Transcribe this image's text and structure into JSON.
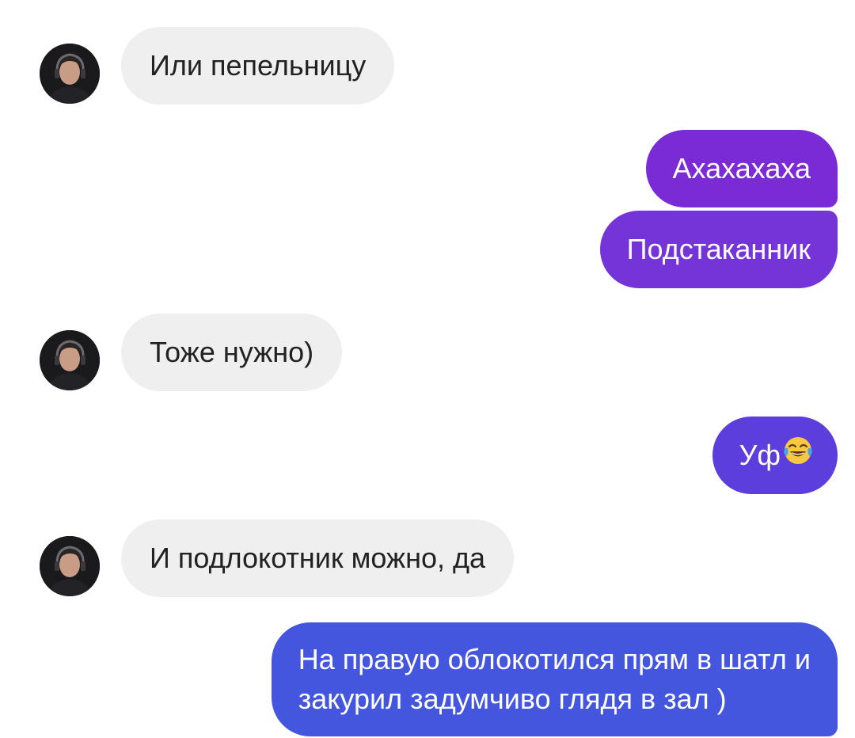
{
  "messages": [
    {
      "direction": "incoming",
      "text": "Или пепельницу"
    },
    {
      "direction": "outgoing",
      "text": "Ахахахаха",
      "color": "#7b2bd6"
    },
    {
      "direction": "outgoing",
      "text": "Подстаканник",
      "color": "#7534d8"
    },
    {
      "direction": "incoming",
      "text": "Тоже нужно)"
    },
    {
      "direction": "outgoing",
      "text": "Уф",
      "emoji": "face-with-tears-of-joy-icon",
      "color": "#5b3edb"
    },
    {
      "direction": "incoming",
      "text": "И подлокотник можно, да"
    },
    {
      "direction": "outgoing",
      "lines": [
        "На правую облокотился прям в шатл и",
        "закурил задумчиво глядя в зал )"
      ],
      "color": "#4456de"
    }
  ],
  "colors": {
    "incoming_bubble": "#efefef",
    "incoming_text": "#222222",
    "outgoing_text": "#ffffff"
  }
}
